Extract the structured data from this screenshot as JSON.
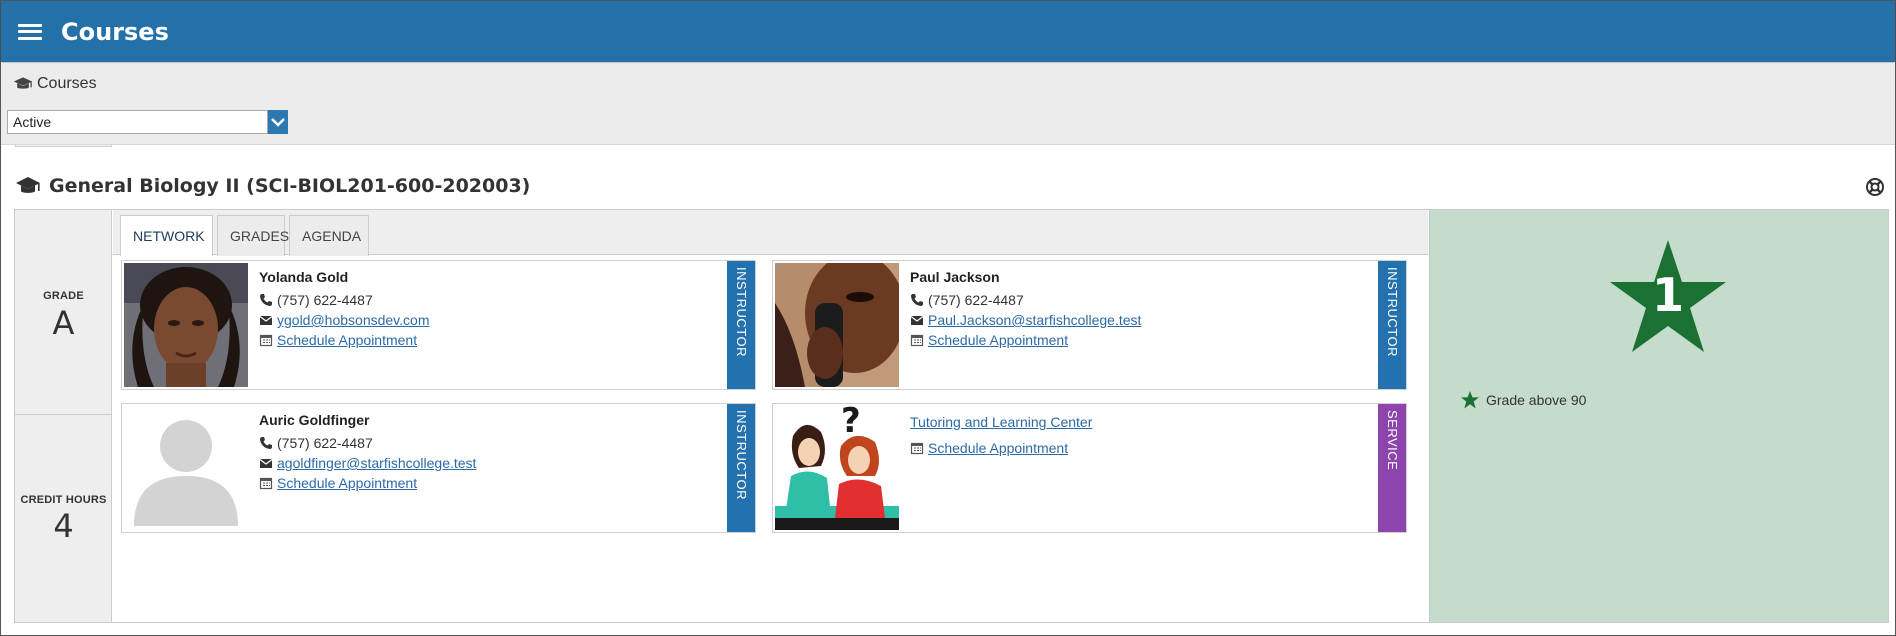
{
  "app": {
    "title": "Courses"
  },
  "breadcrumb": {
    "label": "Courses"
  },
  "filter": {
    "selected": "Active"
  },
  "course": {
    "title": "General Biology II (SCI-BIOL201-600-202003)",
    "grade_label": "GRADE",
    "grade_value": "A",
    "credit_label": "CREDIT HOURS",
    "credit_value": "4"
  },
  "tabs": [
    {
      "label": "NETWORK",
      "active": true
    },
    {
      "label": "GRADES",
      "active": false
    },
    {
      "label": "AGENDA",
      "active": false
    }
  ],
  "contacts": [
    {
      "name": "Yolanda Gold",
      "phone": "(757) 622-4487",
      "email": "ygold@hobsonsdev.com",
      "appointment": "Schedule Appointment",
      "role": "INSTRUCTOR"
    },
    {
      "name": "Paul Jackson",
      "phone": "(757) 622-4487",
      "email": "Paul.Jackson@starfishcollege.test",
      "appointment": "Schedule Appointment",
      "role": "INSTRUCTOR"
    },
    {
      "name": "Auric Goldfinger",
      "phone": "(757) 622-4487",
      "email": "agoldfinger@starfishcollege.test",
      "appointment": "Schedule Appointment",
      "role": "INSTRUCTOR"
    },
    {
      "name": "Tutoring and Learning Center",
      "appointment": "Schedule Appointment",
      "role": "SERVICE"
    }
  ],
  "highlight": {
    "star_count": "1",
    "legend": "Grade above 90"
  },
  "colors": {
    "header": "#2471aa",
    "instructor_tag": "#2371ae",
    "service_tag": "#8e44ad",
    "highlight_bg": "#c5dccd",
    "star": "#1a7132",
    "link": "#2b6aa8"
  },
  "icons": {
    "menu": "hamburger-icon",
    "breadcrumb": "graduation-cap-icon",
    "dropdown": "chevron-down-icon",
    "help": "lifebuoy-icon",
    "phone": "phone-icon",
    "email": "envelope-icon",
    "appointment": "calendar-icon",
    "star": "star-icon"
  }
}
